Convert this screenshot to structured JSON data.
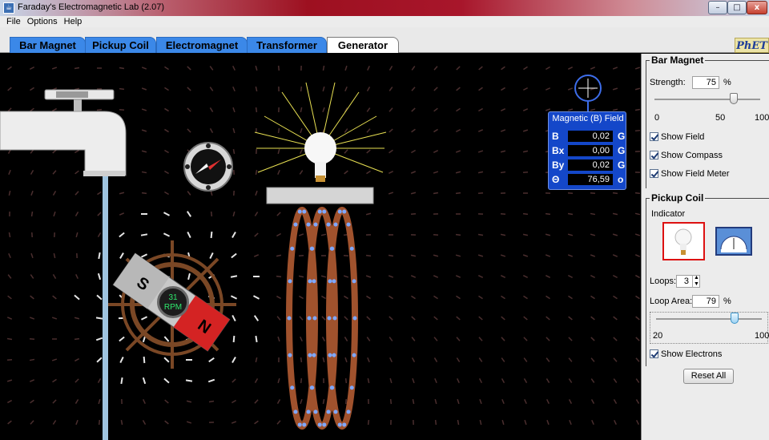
{
  "window": {
    "title": "Faraday's Electromagnetic Lab (2.07)",
    "min_glyph": "–",
    "max_glyph": "□",
    "close_glyph": "x"
  },
  "menu": [
    "File",
    "Options",
    "Help"
  ],
  "tabs": [
    "Bar Magnet",
    "Pickup Coil",
    "Electromagnet",
    "Transformer",
    "Generator"
  ],
  "active_tab": "Generator",
  "logo_text": "PhET",
  "canvas": {
    "rpm_value": "31",
    "rpm_unit": "RPM",
    "magnet_s": "S",
    "magnet_n": "N"
  },
  "field_meter": {
    "title": "Magnetic (B) Field",
    "rows": [
      {
        "label": "B",
        "value": "0,02",
        "unit": "G"
      },
      {
        "label": "Bx",
        "value": "0,00",
        "unit": "G"
      },
      {
        "label": "By",
        "value": "0,02",
        "unit": "G"
      },
      {
        "label": "Θ",
        "value": "76,59",
        "unit": "o"
      }
    ]
  },
  "bar_magnet": {
    "title": "Bar Magnet",
    "strength_label": "Strength:",
    "strength_value": "75",
    "strength_unit": "%",
    "strength_fraction": 0.75,
    "ticks": [
      "0",
      "50",
      "100"
    ],
    "show_field": "Show Field",
    "show_compass": "Show Compass",
    "show_field_meter": "Show Field Meter"
  },
  "pickup_coil": {
    "title": "Pickup Coil",
    "indicator_label": "Indicator",
    "loops_label": "Loops:",
    "loops_value": "3",
    "loop_area_label": "Loop Area:",
    "loop_area_value": "79",
    "loop_area_unit": "%",
    "loop_area_fraction": 0.74,
    "ticks": [
      "20",
      "100"
    ],
    "show_electrons": "Show Electrons"
  },
  "reset_label": "Reset All",
  "colors": {
    "tab_blue": "#3b88e8",
    "meter_blue": "#1447c9",
    "coil_copper": "#a0522d",
    "electron_blue": "#7fa8ff",
    "water": "#9fc4e0",
    "indicator_border": "#dd1111"
  }
}
